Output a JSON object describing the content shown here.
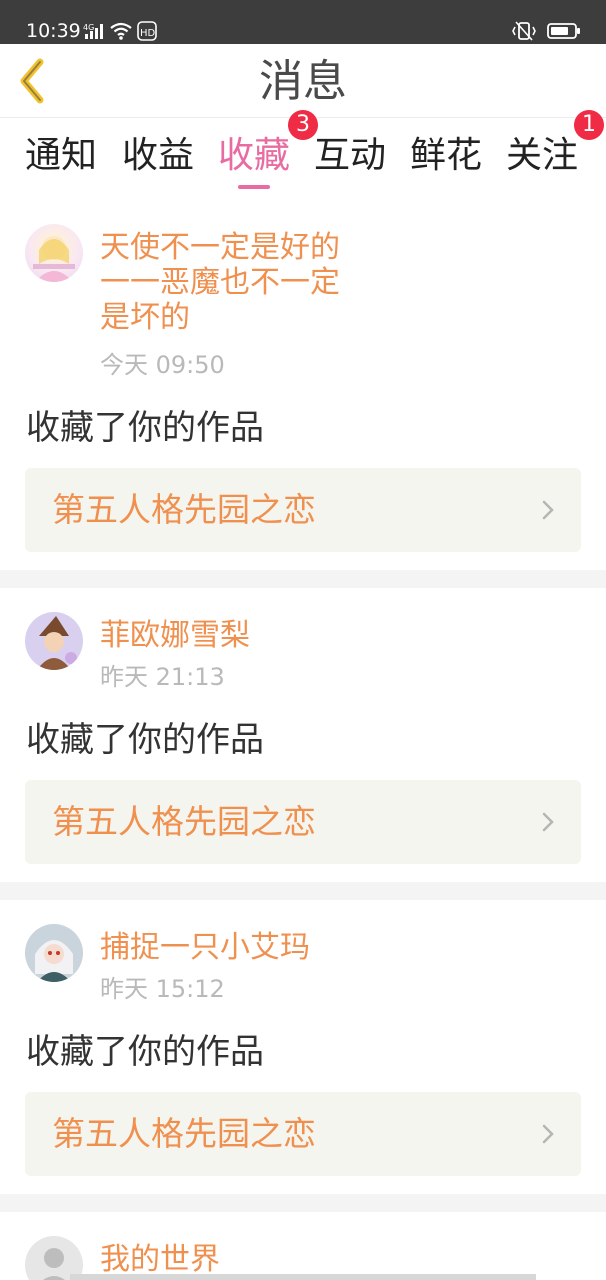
{
  "status_bar": {
    "time": "10:39",
    "network": "4G",
    "wifi_label": "HD"
  },
  "header": {
    "title": "消息"
  },
  "tabs": [
    {
      "label": "通知"
    },
    {
      "label": "收益"
    },
    {
      "label": "收藏",
      "active": true,
      "badge": "3"
    },
    {
      "label": "互动"
    },
    {
      "label": "鲜花"
    },
    {
      "label": "关注",
      "badge": "1"
    }
  ],
  "notifications": [
    {
      "username_lines": [
        "天使不一定是好的",
        "一一恶魔也不一定",
        "是坏的"
      ],
      "time": "今天 09:50",
      "action": "收藏了你的作品",
      "work_title": "第五人格先园之恋"
    },
    {
      "username_lines": [
        "菲欧娜雪梨"
      ],
      "time": "昨天 21:13",
      "action": "收藏了你的作品",
      "work_title": "第五人格先园之恋"
    },
    {
      "username_lines": [
        "捕捉一只小艾玛"
      ],
      "time": "昨天 15:12",
      "action": "收藏了你的作品",
      "work_title": "第五人格先园之恋"
    },
    {
      "username_lines": [
        "我的世界"
      ]
    }
  ],
  "colors": {
    "accent": "#e86ba2",
    "username": "#f0904f",
    "badge": "#ef2b45",
    "link_bg": "#f5f5ef"
  }
}
